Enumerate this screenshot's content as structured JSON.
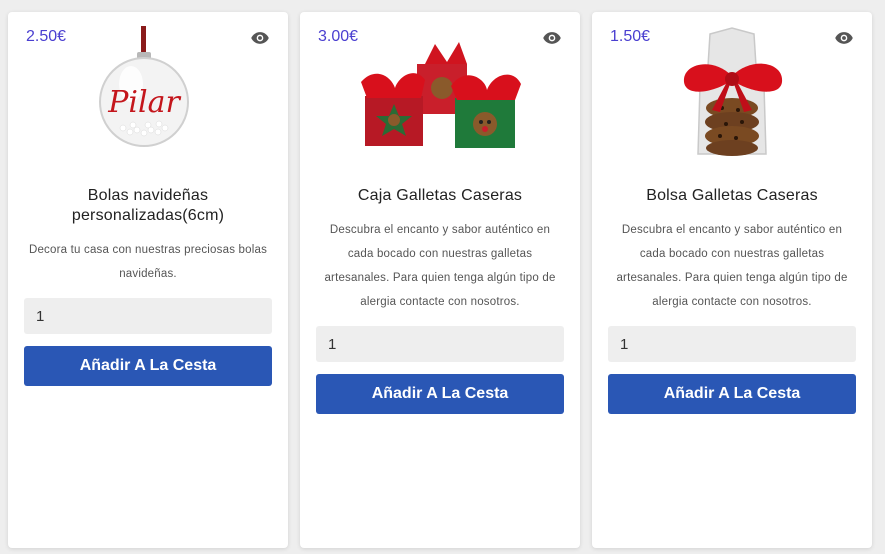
{
  "products": [
    {
      "price": "2.50€",
      "image_icon": "christmas-ornament-ball",
      "image_text": "Pilar",
      "title": "Bolas navideñas personalizadas(6cm)",
      "description": "Decora tu casa con nuestras preciosas bolas navideñas.",
      "quantity": "1",
      "button_label": "Añadir A La Cesta"
    },
    {
      "price": "3.00€",
      "image_icon": "cookie-gift-boxes",
      "title": "Caja Galletas Caseras",
      "description": "Descubra el encanto y sabor auténtico en cada bocado con nuestras galletas artesanales. Para quien tenga algún tipo de alergia contacte con nosotros.",
      "quantity": "1",
      "button_label": "Añadir A La Cesta"
    },
    {
      "price": "1.50€",
      "image_icon": "cookie-bag-with-bow",
      "title": "Bolsa Galletas Caseras",
      "description": "Descubra el encanto y sabor auténtico en cada bocado con nuestras galletas artesanales. Para quien tenga algún tipo de alergia contacte con nosotros.",
      "quantity": "1",
      "button_label": "Añadir A La Cesta"
    }
  ],
  "colors": {
    "price": "#4a3fd0",
    "button": "#2a57b5",
    "input_bg": "#eeeeee"
  }
}
